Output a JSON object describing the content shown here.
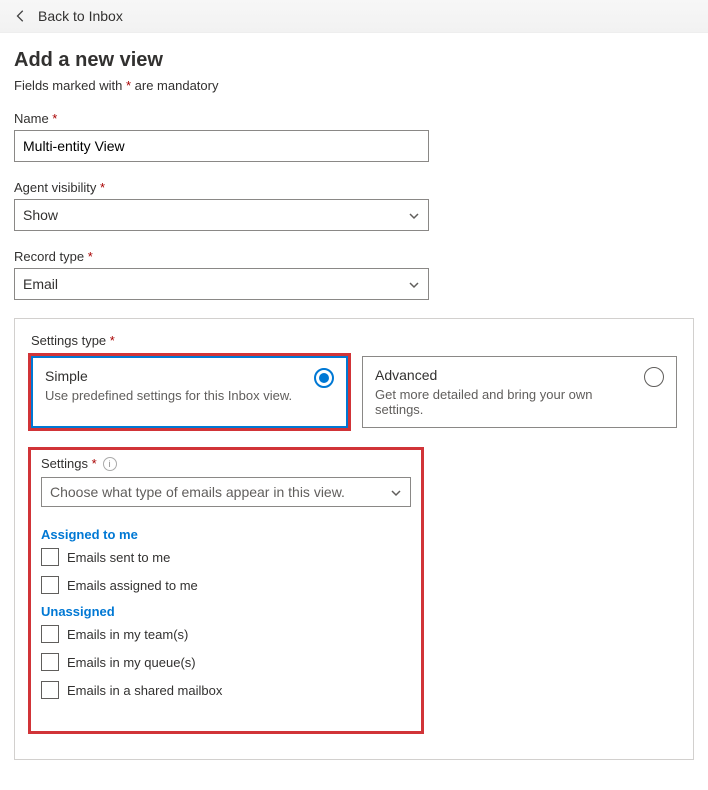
{
  "back": {
    "label": "Back to Inbox"
  },
  "page": {
    "title": "Add a new view",
    "mandatory_pre": "Fields marked with ",
    "mandatory_star": "*",
    "mandatory_post": " are mandatory"
  },
  "name": {
    "label": "Name ",
    "value": "Multi-entity View"
  },
  "agent_visibility": {
    "label": "Agent visibility ",
    "value": "Show"
  },
  "record_type": {
    "label": "Record type ",
    "value": "Email"
  },
  "settings_type": {
    "label": "Settings type ",
    "simple": {
      "title": "Simple",
      "desc": "Use predefined settings for this Inbox view."
    },
    "advanced": {
      "title": "Advanced",
      "desc": "Get more detailed and bring your own settings."
    }
  },
  "settings": {
    "label": "Settings ",
    "placeholder": "Choose what type of emails appear in this view.",
    "groups": {
      "assigned": {
        "title": "Assigned to me",
        "opt1": "Emails sent to me",
        "opt2": "Emails assigned to me"
      },
      "unassigned": {
        "title": "Unassigned",
        "opt1": "Emails in my team(s)",
        "opt2": "Emails in my queue(s)",
        "opt3": "Emails in a shared mailbox"
      }
    }
  }
}
